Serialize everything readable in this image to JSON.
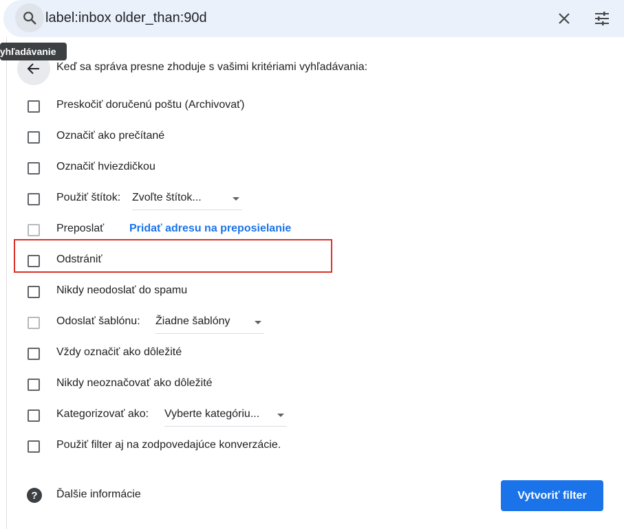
{
  "search": {
    "query": "label:inbox older_than:90d",
    "search_icon": "search-icon",
    "close_icon": "close-icon",
    "options_icon": "tune-icon"
  },
  "tooltip": {
    "text": "Vyhľadávanie"
  },
  "filter": {
    "back_icon": "arrow-back-icon",
    "header": "Keď sa správa presne zhoduje s vašimi kritériami vyhľadávania:",
    "options": [
      {
        "label": "Preskočiť doručenú poštu (Archivovať)",
        "checked": false
      },
      {
        "label": "Označiť ako prečítané",
        "checked": false
      },
      {
        "label": "Označiť hviezdičkou",
        "checked": false
      },
      {
        "label": "Použiť štítok:",
        "checked": false,
        "select": "Zvoľte štítok..."
      },
      {
        "label": "Preposlať",
        "checked": false,
        "disabled": true,
        "link": "Pridať adresu na preposielanie"
      },
      {
        "label": "Odstrániť",
        "checked": false,
        "highlighted": true
      },
      {
        "label": "Nikdy neodoslať do spamu",
        "checked": false
      },
      {
        "label": "Odoslať šablónu:",
        "checked": false,
        "disabled": true,
        "select": "Žiadne šablóny"
      },
      {
        "label": "Vždy označiť ako dôležité",
        "checked": false
      },
      {
        "label": "Nikdy neoznačovať ako dôležité",
        "checked": false
      },
      {
        "label": "Kategorizovať ako:",
        "checked": false,
        "select": "Vyberte kategóriu..."
      },
      {
        "label": "Použiť filter aj na zodpovedajúce konverzácie.",
        "checked": false
      }
    ],
    "help_text": "Ďalšie informácie",
    "help_icon": "help-icon",
    "create_button": "Vytvoriť filter"
  },
  "colors": {
    "accent": "#1a73e8",
    "highlight_border": "#d93025",
    "search_bg": "#eaf1fb"
  }
}
